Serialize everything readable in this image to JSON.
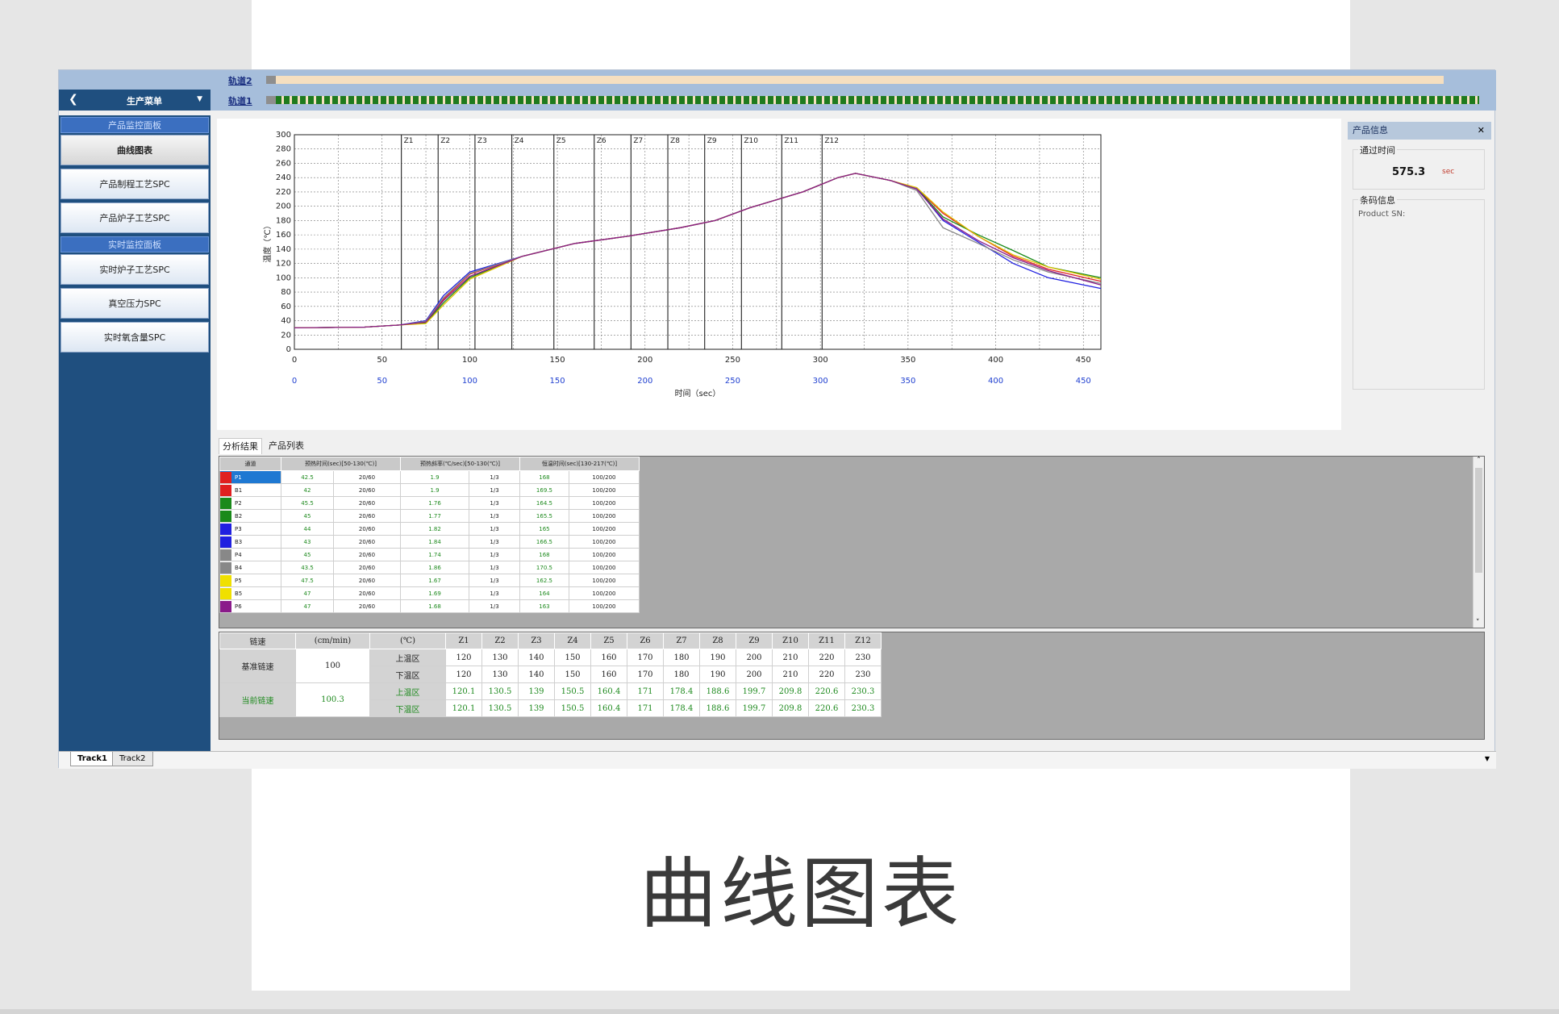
{
  "caption": "曲线图表",
  "menu": {
    "title": "生产菜单"
  },
  "tracks": {
    "track2": "轨道2",
    "track1": "轨道1"
  },
  "sidebar": {
    "panel1": "产品监控面板",
    "items1": [
      "曲线图表",
      "产品制程工艺SPC",
      "产品炉子工艺SPC"
    ],
    "panel2": "实时监控面板",
    "items2": [
      "实时炉子工艺SPC",
      "真空压力SPC",
      "实时氧含量SPC"
    ]
  },
  "chart_data": {
    "type": "line",
    "title": "",
    "xlabel": "时间（sec）",
    "ylabel": "温度（℃）",
    "xlim": [
      0,
      460
    ],
    "ylim": [
      0,
      300
    ],
    "x_ticks": [
      0,
      50,
      100,
      150,
      200,
      250,
      300,
      350,
      400,
      450
    ],
    "y_ticks": [
      0,
      20,
      40,
      60,
      80,
      100,
      120,
      140,
      160,
      180,
      200,
      220,
      240,
      260,
      280,
      300
    ],
    "grid": true,
    "zones": [
      {
        "name": "Z1",
        "x": 61
      },
      {
        "name": "Z2",
        "x": 82
      },
      {
        "name": "Z3",
        "x": 103
      },
      {
        "name": "Z4",
        "x": 124
      },
      {
        "name": "Z5",
        "x": 148
      },
      {
        "name": "Z6",
        "x": 171
      },
      {
        "name": "Z7",
        "x": 192
      },
      {
        "name": "Z8",
        "x": 213
      },
      {
        "name": "Z9",
        "x": 234
      },
      {
        "name": "Z10",
        "x": 255
      },
      {
        "name": "Z11",
        "x": 278
      },
      {
        "name": "Z12",
        "x": 301
      }
    ],
    "series": [
      {
        "color": "#e02020",
        "x": [
          0,
          40,
          60,
          75,
          85,
          100,
          130,
          160,
          190,
          220,
          240,
          260,
          290,
          310,
          320,
          340,
          355,
          370,
          390,
          410,
          430,
          460
        ],
        "y": [
          30,
          31,
          34,
          38,
          70,
          105,
          130,
          148,
          158,
          170,
          180,
          198,
          220,
          240,
          246,
          236,
          225,
          190,
          158,
          130,
          112,
          95
        ]
      },
      {
        "color": "#1a8a1a",
        "x": [
          0,
          40,
          60,
          75,
          85,
          100,
          130,
          160,
          190,
          220,
          240,
          260,
          290,
          310,
          320,
          340,
          355,
          370,
          390,
          410,
          430,
          460
        ],
        "y": [
          30,
          31,
          34,
          37,
          65,
          100,
          130,
          148,
          158,
          170,
          180,
          198,
          220,
          240,
          246,
          236,
          225,
          185,
          160,
          138,
          115,
          100
        ]
      },
      {
        "color": "#2020e0",
        "x": [
          0,
          40,
          60,
          75,
          85,
          100,
          130,
          160,
          190,
          220,
          240,
          260,
          290,
          310,
          320,
          340,
          355,
          370,
          390,
          410,
          430,
          460
        ],
        "y": [
          30,
          31,
          34,
          40,
          75,
          108,
          130,
          148,
          158,
          170,
          180,
          198,
          220,
          240,
          246,
          236,
          225,
          180,
          150,
          120,
          100,
          85
        ]
      },
      {
        "color": "#888888",
        "x": [
          0,
          40,
          60,
          75,
          85,
          100,
          130,
          160,
          190,
          220,
          240,
          260,
          290,
          310,
          320,
          340,
          355,
          370,
          390,
          410,
          430,
          460
        ],
        "y": [
          30,
          31,
          34,
          39,
          72,
          106,
          130,
          148,
          158,
          170,
          180,
          198,
          220,
          240,
          246,
          236,
          222,
          170,
          148,
          125,
          108,
          92
        ]
      },
      {
        "color": "#e0c000",
        "x": [
          0,
          40,
          60,
          75,
          85,
          100,
          130,
          160,
          190,
          220,
          240,
          260,
          290,
          310,
          320,
          340,
          355,
          370,
          390,
          410,
          430,
          460
        ],
        "y": [
          30,
          31,
          34,
          36,
          62,
          98,
          130,
          148,
          158,
          170,
          180,
          198,
          220,
          240,
          246,
          236,
          226,
          192,
          158,
          132,
          115,
          98
        ]
      },
      {
        "color": "#8a1a8a",
        "x": [
          0,
          40,
          60,
          75,
          85,
          100,
          130,
          160,
          190,
          220,
          240,
          260,
          290,
          310,
          320,
          340,
          355,
          370,
          390,
          410,
          430,
          460
        ],
        "y": [
          30,
          31,
          34,
          38,
          68,
          102,
          130,
          148,
          158,
          170,
          180,
          198,
          220,
          240,
          246,
          236,
          224,
          182,
          152,
          128,
          110,
          90
        ]
      }
    ]
  },
  "info": {
    "title": "产品信息",
    "pass_label": "通过时间",
    "pass_value": "575.3",
    "pass_unit": "sec",
    "barcode_label": "条码信息",
    "sn_label": "Product SN:"
  },
  "tabs": {
    "analysis": "分析结果",
    "products": "产品列表"
  },
  "results": {
    "headers": [
      "通道",
      "预热时间(sec)[50-130(℃)]",
      "",
      "预热斜率(℃/sec)[50-130(℃)]",
      "",
      "恒温时间(sec)[130-217(℃)]",
      ""
    ],
    "rows": [
      {
        "color": "#e02020",
        "ch": "P1",
        "a": "42.5",
        "b": "20/60",
        "c": "1.9",
        "d": "1/3",
        "e": "168",
        "f": "100/200"
      },
      {
        "color": "#e02020",
        "ch": "B1",
        "a": "42",
        "b": "20/60",
        "c": "1.9",
        "d": "1/3",
        "e": "169.5",
        "f": "100/200"
      },
      {
        "color": "#1a8a1a",
        "ch": "P2",
        "a": "45.5",
        "b": "20/60",
        "c": "1.76",
        "d": "1/3",
        "e": "164.5",
        "f": "100/200"
      },
      {
        "color": "#1a8a1a",
        "ch": "B2",
        "a": "45",
        "b": "20/60",
        "c": "1.77",
        "d": "1/3",
        "e": "165.5",
        "f": "100/200"
      },
      {
        "color": "#2020e0",
        "ch": "P3",
        "a": "44",
        "b": "20/60",
        "c": "1.82",
        "d": "1/3",
        "e": "165",
        "f": "100/200"
      },
      {
        "color": "#2020e0",
        "ch": "B3",
        "a": "43",
        "b": "20/60",
        "c": "1.84",
        "d": "1/3",
        "e": "166.5",
        "f": "100/200"
      },
      {
        "color": "#888888",
        "ch": "P4",
        "a": "45",
        "b": "20/60",
        "c": "1.74",
        "d": "1/3",
        "e": "168",
        "f": "100/200"
      },
      {
        "color": "#888888",
        "ch": "B4",
        "a": "43.5",
        "b": "20/60",
        "c": "1.86",
        "d": "1/3",
        "e": "170.5",
        "f": "100/200"
      },
      {
        "color": "#f0e000",
        "ch": "P5",
        "a": "47.5",
        "b": "20/60",
        "c": "1.67",
        "d": "1/3",
        "e": "162.5",
        "f": "100/200"
      },
      {
        "color": "#f0e000",
        "ch": "B5",
        "a": "47",
        "b": "20/60",
        "c": "1.69",
        "d": "1/3",
        "e": "164",
        "f": "100/200"
      },
      {
        "color": "#8a1a8a",
        "ch": "P6",
        "a": "47",
        "b": "20/60",
        "c": "1.68",
        "d": "1/3",
        "e": "163",
        "f": "100/200"
      }
    ]
  },
  "zones_table": {
    "h_speed": "链速",
    "h_unit": "(cm/min)",
    "h_temp": "(℃)",
    "zones": [
      "Z1",
      "Z2",
      "Z3",
      "Z4",
      "Z5",
      "Z6",
      "Z7",
      "Z8",
      "Z9",
      "Z10",
      "Z11",
      "Z12"
    ],
    "std_label": "基准链速",
    "std_speed": "100",
    "cur_label": "当前链速",
    "cur_speed": "100.3",
    "upper": "上温区",
    "lower": "下温区",
    "std_upper": [
      "120",
      "130",
      "140",
      "150",
      "160",
      "170",
      "180",
      "190",
      "200",
      "210",
      "220",
      "230"
    ],
    "std_lower": [
      "120",
      "130",
      "140",
      "150",
      "160",
      "170",
      "180",
      "190",
      "200",
      "210",
      "220",
      "230"
    ],
    "cur_upper": [
      "120.1",
      "130.5",
      "139",
      "150.5",
      "160.4",
      "171",
      "178.4",
      "188.6",
      "199.7",
      "209.8",
      "220.6",
      "230.3"
    ],
    "cur_lower": [
      "120.1",
      "130.5",
      "139",
      "150.5",
      "160.4",
      "171",
      "178.4",
      "188.6",
      "199.7",
      "209.8",
      "220.6",
      "230.3"
    ]
  },
  "bottom_tabs": [
    "Track1",
    "Track2"
  ]
}
